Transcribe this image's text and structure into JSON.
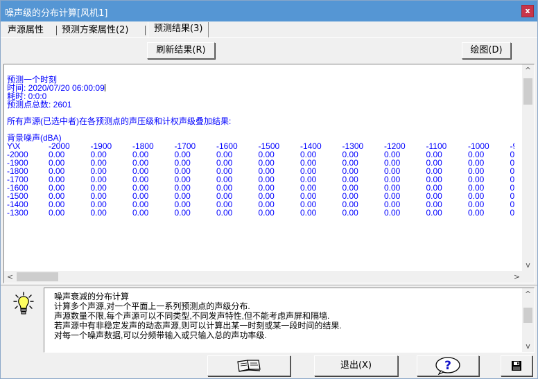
{
  "window": {
    "title": "噪声级的分布计算[风机1]",
    "close_glyph": "x"
  },
  "tabs": [
    {
      "label": "声源属性"
    },
    {
      "label": "预测方案属性(2)"
    },
    {
      "label": "预测结果(3)"
    }
  ],
  "toolbar": {
    "refresh_label": "刷新结果(R)",
    "plot_label": "绘图(D)"
  },
  "output": {
    "heading": "预测一个时刻",
    "time_line": "时间: 2020/07/20 06:00:09",
    "elapsed_line": "耗时: 0:0:0",
    "points_line": "预测点总数: 2601",
    "summary_line": "所有声源(已选中者)在各预测点的声压级和计权声级叠加结果:",
    "section_title": "背景噪声(dBA)",
    "grid": {
      "corner": "Y\\X",
      "columns": [
        "-2000",
        "-1900",
        "-1800",
        "-1700",
        "-1600",
        "-1500",
        "-1400",
        "-1300",
        "-1200",
        "-1100",
        "-1000",
        "-9"
      ],
      "rows": [
        {
          "y": "-2000",
          "values": [
            "0.00",
            "0.00",
            "0.00",
            "0.00",
            "0.00",
            "0.00",
            "0.00",
            "0.00",
            "0.00",
            "0.00",
            "0.00",
            "0."
          ]
        },
        {
          "y": "-1900",
          "values": [
            "0.00",
            "0.00",
            "0.00",
            "0.00",
            "0.00",
            "0.00",
            "0.00",
            "0.00",
            "0.00",
            "0.00",
            "0.00",
            "0."
          ]
        },
        {
          "y": "-1800",
          "values": [
            "0.00",
            "0.00",
            "0.00",
            "0.00",
            "0.00",
            "0.00",
            "0.00",
            "0.00",
            "0.00",
            "0.00",
            "0.00",
            "0."
          ]
        },
        {
          "y": "-1700",
          "values": [
            "0.00",
            "0.00",
            "0.00",
            "0.00",
            "0.00",
            "0.00",
            "0.00",
            "0.00",
            "0.00",
            "0.00",
            "0.00",
            "0."
          ]
        },
        {
          "y": "-1600",
          "values": [
            "0.00",
            "0.00",
            "0.00",
            "0.00",
            "0.00",
            "0.00",
            "0.00",
            "0.00",
            "0.00",
            "0.00",
            "0.00",
            "0."
          ]
        },
        {
          "y": "-1500",
          "values": [
            "0.00",
            "0.00",
            "0.00",
            "0.00",
            "0.00",
            "0.00",
            "0.00",
            "0.00",
            "0.00",
            "0.00",
            "0.00",
            "0."
          ]
        },
        {
          "y": "-1400",
          "values": [
            "0.00",
            "0.00",
            "0.00",
            "0.00",
            "0.00",
            "0.00",
            "0.00",
            "0.00",
            "0.00",
            "0.00",
            "0.00",
            "0."
          ]
        },
        {
          "y": "-1300",
          "values": [
            "0.00",
            "0.00",
            "0.00",
            "0.00",
            "0.00",
            "0.00",
            "0.00",
            "0.00",
            "0.00",
            "0.00",
            "0.00",
            "0."
          ]
        }
      ]
    }
  },
  "scroll_glyphs": {
    "up": "^",
    "down": "v",
    "left": "<",
    "right": ">"
  },
  "description": {
    "lines": [
      "噪声衰减的分布计算",
      "计算多个声源,对一个平面上一系列预测点的声级分布.",
      "声源数量不限,每个声源可以不同类型,不同发声特性,但不能考虑声屏和隔墙.",
      "若声源中有非稳定发声的动态声源,则可以计算出某一时刻或某一段时间的结果.",
      "对每一个噪声数据,可以分频带输入或只输入总的声功率级."
    ]
  },
  "bottom": {
    "exit_label": "退出(X)",
    "help_glyph": "?"
  },
  "icons": {
    "bulb": "lightbulb-icon",
    "book": "book-icon",
    "help": "help-icon",
    "save": "save-icon"
  },
  "colors": {
    "titlebar": "#5596d4",
    "output_text": "#0000ff",
    "close": "#c8354a"
  }
}
